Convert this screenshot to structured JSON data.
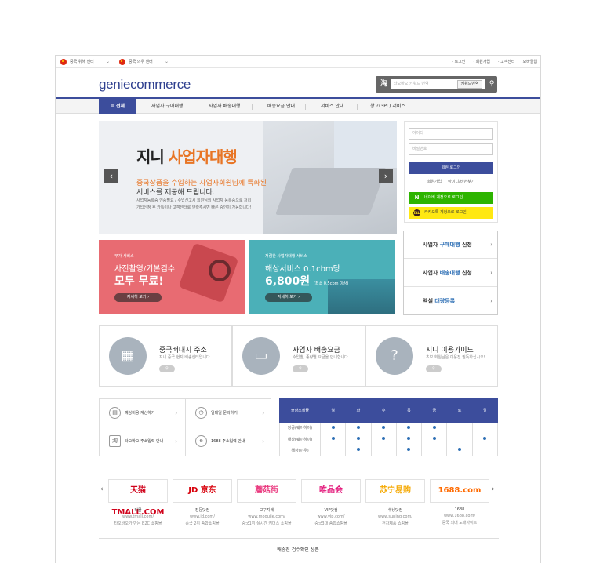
{
  "topbar": {
    "center1": "중국 위해 센터",
    "center2": "중국 의우 센터",
    "links": [
      "· 로그인",
      "· 회원가입",
      "· 고객센터",
      "모바일웹"
    ]
  },
  "logo": "geniecommerce",
  "search": {
    "placeholder": "타오바오 키워드 번역",
    "keyword_btn": "키워드번역"
  },
  "nav": {
    "all": "≡ 전체",
    "items": [
      "사업자 구매대행",
      "사업자 배송대행",
      "배송요금 안내",
      "서비스 안내",
      "창고(3PL) 서비스"
    ]
  },
  "hero": {
    "title_a": "지니 ",
    "title_b": "사업자대행",
    "line1": "중국상품을 수입하는 사업자회원님께 특화된",
    "line2": "서비스를 제공해 드립니다.",
    "line3": "사업자등록증 인증필요 / 수입신고시 회원님의 사업자 등록증으로 처리",
    "line4": "가입신청 후 카톡이나 고객센터로 연락주시면 빠른 승인이 가능합니다!"
  },
  "login": {
    "id_placeholder": "아이디",
    "pw_placeholder": "비밀번호",
    "login_btn": "회원 로그인",
    "join": "회원가입",
    "find": "아이디/비번찾기",
    "naver": "네이버 계정으로 로그인",
    "kakao": "카카오톡 계정으로 로그인"
  },
  "biz_links": [
    {
      "a": "사업자 ",
      "b": "구매대행",
      "c": " 신청"
    },
    {
      "a": "사업자 ",
      "b": "배송대행",
      "c": " 신청"
    },
    {
      "a": "엑셀 ",
      "b": "대량등록",
      "c": ""
    }
  ],
  "banner1": {
    "small": "부가 서비스",
    "mid": "사진촬영/기본검수",
    "big": "모두 무료!",
    "more": "자세히 보기  ›"
  },
  "banner2": {
    "small": "저렴한 사업자대행 서비스",
    "mid": "해상서비스 0.1cbm당",
    "big": "6,800원",
    "note": "(최소 0.5cbm 이상)",
    "more": "자세히 보기  ›"
  },
  "services": [
    {
      "title": "중국배대지 주소",
      "desc": "지니 중국 현지 배송센터입니다."
    },
    {
      "title": "사업자 배송요금",
      "desc": "수입별, 종량별 요금을 안내합니다."
    },
    {
      "title": "지니 이용가이드",
      "desc": "초보 회원님은 이용전 필독하십시오!"
    }
  ],
  "quick": [
    "예상비용 계산하기",
    "일대일 문의하기",
    "타오바오 주소입력 안내",
    "1688 주소입력 안내"
  ],
  "schedule": {
    "header": "출항스케쥴",
    "days": [
      "월",
      "화",
      "수",
      "목",
      "금",
      "토",
      "일"
    ],
    "rows": [
      {
        "label": "항공(웨이하이)",
        "dots": [
          1,
          1,
          1,
          1,
          1,
          0,
          0
        ]
      },
      {
        "label": "해상(웨이하이)",
        "dots": [
          1,
          1,
          1,
          1,
          1,
          0,
          1
        ]
      },
      {
        "label": "해상(이우)",
        "dots": [
          0,
          1,
          0,
          1,
          0,
          1,
          0
        ]
      }
    ]
  },
  "shops": [
    {
      "logo": "天猫 TMALL.COM",
      "name": "티몰",
      "url": "www.tmall.com/",
      "desc": "타오바오가 만든 B2C 쇼핑몰"
    },
    {
      "logo": "JD 京东",
      "name": "징둥닷컴",
      "url": "www.jd.com/",
      "desc": "중국 2위 종합쇼핑몰"
    },
    {
      "logo": "蘑菇街",
      "name": "모구지에",
      "url": "www.mogujie.com/",
      "desc": "중국1위 실시간 커머스 쇼핑몰"
    },
    {
      "logo": "唯品会",
      "name": "VIP닷컴",
      "url": "www.vip.com/",
      "desc": "중국3대 종합쇼핑몰"
    },
    {
      "logo": "苏宁易购",
      "name": "쑤닝닷컴",
      "url": "www.suning.com/",
      "desc": "전자제품 쇼핑몰"
    },
    {
      "logo": "1688.com",
      "name": "1688",
      "url": "www.1688.com/",
      "desc": "중국 최대 도매사이트"
    }
  ],
  "bottom_title": "배송전 검수확인 상품",
  "colors": {
    "brand": "#3c4d9c",
    "naver": "#2db400",
    "kakao": "#ffe812",
    "banner1": "#e86b72",
    "banner2": "#4bb0b8"
  }
}
